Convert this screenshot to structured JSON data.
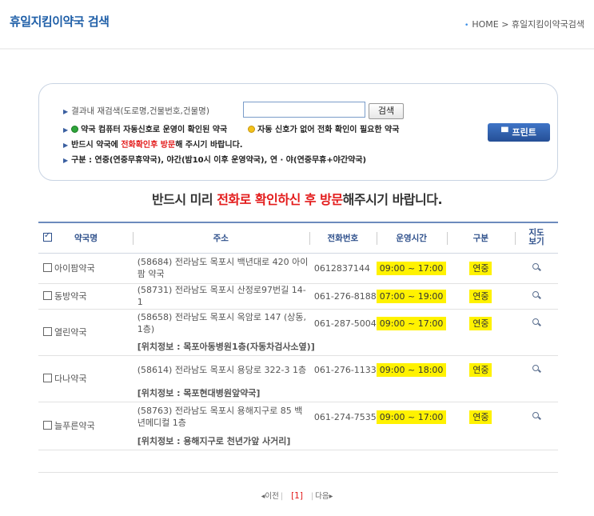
{
  "header": {
    "title": "휴일지킴이약국 검색",
    "breadcrumb": "HOME > 휴일지킴이약국검색"
  },
  "search": {
    "line1": "결과내 재검색(도로명,건물번호,건물명)",
    "input_value": "",
    "button_label": "검색",
    "legend_green": "약국 컴퓨터 자동신호로 운영이 확인된 약국",
    "legend_yellow": "자동 신호가 없어 전화 확인이 필요한 약국",
    "line3_pre": "반드시 약국에 ",
    "line3_red": "전화확인후 방문",
    "line3_post": "해 주시기 바랍니다.",
    "line4": "구분 : 연중(연중무휴약국), 야간(밤10시 이후 운영약국), 연 · 야(연중무휴+야간약국)",
    "print_label": "프린트"
  },
  "notice": {
    "pre": "반드시 미리 ",
    "red": "전화로 확인하신 후 방문",
    "post": "해주시기 바랍니다."
  },
  "table": {
    "headers": {
      "name": "약국명",
      "address": "주소",
      "phone": "전화번호",
      "hours": "운영시간",
      "type": "구분",
      "map": "지도보기"
    },
    "rows": [
      {
        "name": "아이팜약국",
        "address": "(58684) 전라남도 목포시 백년대로 420 아이팜 약국",
        "phone": "0612837144",
        "hours": "09:00 ~ 17:00",
        "type": "연중",
        "location": ""
      },
      {
        "name": "동방약국",
        "address": "(58731) 전라남도 목포시 산정로97번길 14-1",
        "phone": "061-276-8188",
        "hours": "07:00 ~ 19:00",
        "type": "연중",
        "location": ""
      },
      {
        "name": "열린약국",
        "address": "(58658) 전라남도 목포시 옥암로 147 (상동, 1층)",
        "phone": "061-287-5004",
        "hours": "09:00 ~ 17:00",
        "type": "연중",
        "location": "[위치정보 : 목포아동병원1층(자동차검사소옆)]"
      },
      {
        "name": "다나약국",
        "address": "(58614) 전라남도 목포시 용당로 322-3 1층",
        "phone": "061-276-1133",
        "hours": "09:00 ~ 18:00",
        "type": "연중",
        "location": "[위치정보 : 목포현대병원앞약국]"
      },
      {
        "name": "늘푸른약국",
        "address": "(58763) 전라남도 목포시 용해지구로 85 백년메디컬 1층",
        "phone": "061-274-7535",
        "hours": "09:00 ~ 17:00",
        "type": "연중",
        "location": "[위치정보 : 용해지구로 천년가앞 사거리]"
      }
    ]
  },
  "pager": {
    "prev": "이전",
    "current": "[1]",
    "next": "다음"
  },
  "colors": {
    "title_blue": "#1f5fa8",
    "highlight": "#fff200",
    "red": "#e31b1b"
  }
}
